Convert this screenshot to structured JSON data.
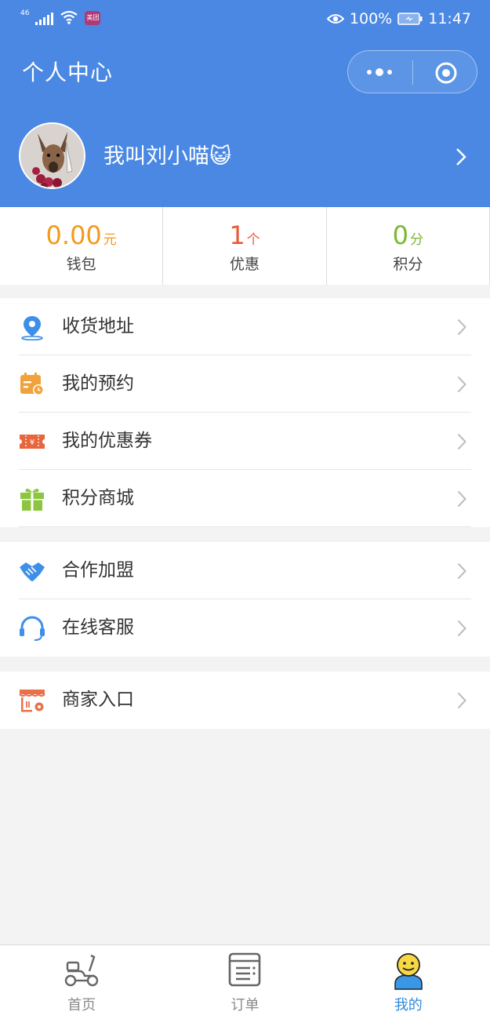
{
  "status_bar": {
    "network": "46",
    "app_badge": "美团",
    "battery": "100%",
    "time": "11:47"
  },
  "header": {
    "title": "个人中心",
    "more_icon": "more-dots-icon",
    "close_icon": "target-close-icon"
  },
  "profile": {
    "username": "我叫刘小喵😺"
  },
  "stats": [
    {
      "value": "0.00",
      "unit": "元",
      "label": "钱包",
      "color": "#f29a1c"
    },
    {
      "value": "1",
      "unit": "个",
      "label": "优惠",
      "color": "#ea5a3b"
    },
    {
      "value": "0",
      "unit": "分",
      "label": "积分",
      "color": "#7ab82f"
    }
  ],
  "menu_group_1": [
    {
      "label": "收货地址",
      "icon": "location-pin-icon"
    },
    {
      "label": "我的预约",
      "icon": "calendar-clock-icon"
    },
    {
      "label": "我的优惠券",
      "icon": "coupon-ticket-icon"
    },
    {
      "label": "积分商城",
      "icon": "gift-icon"
    }
  ],
  "menu_group_2": [
    {
      "label": "合作加盟",
      "icon": "handshake-icon"
    },
    {
      "label": "在线客服",
      "icon": "headset-icon"
    }
  ],
  "menu_group_3": [
    {
      "label": "商家入口",
      "icon": "storefront-icon"
    }
  ],
  "tabbar": [
    {
      "label": "首页",
      "icon": "scooter-icon",
      "active": false
    },
    {
      "label": "订单",
      "icon": "order-list-icon",
      "active": false
    },
    {
      "label": "我的",
      "icon": "user-smiley-icon",
      "active": true
    }
  ],
  "colors": {
    "header_blue": "#4a88e4",
    "active_tab": "#2f8cde",
    "background": "#f3f3f3"
  }
}
